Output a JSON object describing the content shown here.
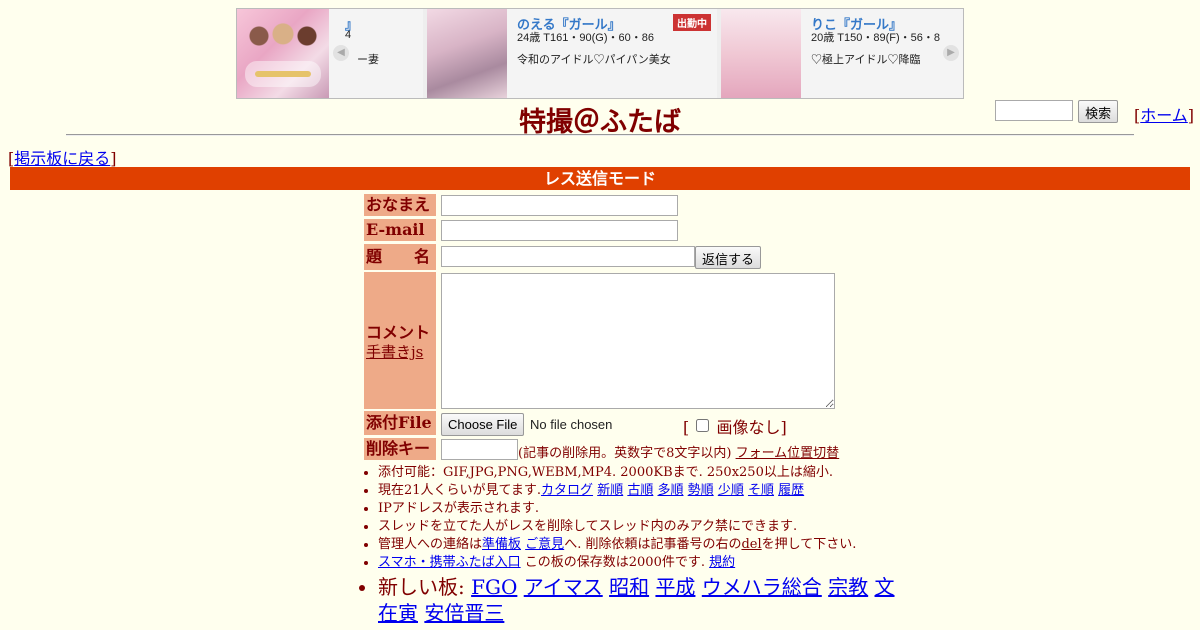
{
  "ad": {
    "cards": [
      {
        "name_partial": "』",
        "stats_partial": "4",
        "desc_partial": "ー妻"
      },
      {
        "name": "のえる『ガール』",
        "stats": "24歳 T161・90(G)・60・86",
        "desc": "令和のアイドル♡パイパン美女",
        "badge": "出勤中"
      },
      {
        "name": "りこ『ガール』",
        "stats": "20歳 T150・89(F)・56・8",
        "desc": "♡極上アイドル♡降臨"
      }
    ]
  },
  "header": {
    "site_title": "特撮＠ふたば",
    "search_button": "検索",
    "home_bracket_open": "[",
    "home_link": "ホーム",
    "home_bracket_close": "]"
  },
  "nav": {
    "back_open": "[",
    "back_link": "掲示板に戻る",
    "back_close": "]"
  },
  "mode_bar": "レス送信モード",
  "form": {
    "name_label": "おなまえ",
    "email_label": "E-mail",
    "subject_label": "題　　名",
    "submit_button": "返信する",
    "comment_label": "コメント",
    "handwrite_link": "手書きjs",
    "file_label": "添付File",
    "choose_file_button": "Choose File",
    "no_file_text": "No file chosen",
    "no_image_open": "[",
    "no_image_label": "画像なし",
    "no_image_close": "]",
    "delkey_label": "削除キー",
    "delkey_note": "(記事の削除用。英数字で8文字以内)",
    "form_position_link": "フォーム位置切替"
  },
  "notes": {
    "attach": "添付可能：GIF,JPG,PNG,WEBM,MP4. 2000KBまで. 250x250以上は縮小.",
    "viewers_text": "現在21人くらいが見てます.",
    "viewer_links": [
      "カタログ",
      "新順",
      "古順",
      "多順",
      "勢順",
      "少順",
      "そ順",
      "履歴"
    ],
    "ip": "IPアドレスが表示されます.",
    "thread_owner": "スレッドを立てた人がレスを削除してスレッド内のみアク禁にできます.",
    "contact_pre": "管理人への連絡は",
    "contact_link1": "準備板",
    "contact_link2": "ご意見",
    "contact_mid": "へ. 削除依頼は記事番号の右の",
    "contact_del": "del",
    "contact_post": "を押して下さい.",
    "mobile_link": "スマホ・携帯ふたば入口",
    "storage_text": " この板の保存数は2000件です.",
    "rules_link": "規約",
    "new_boards_label": "新しい板:",
    "new_boards": [
      "FGO",
      "アイマス",
      "昭和",
      "平成",
      "ウメハラ総合",
      "宗教",
      "文在寅",
      "安倍晋三"
    ]
  },
  "colors": {
    "background": "#ffffee",
    "text": "#800000",
    "mode_bar": "#e04000",
    "label_bg": "#eeaa88",
    "link": "#0000ee"
  }
}
